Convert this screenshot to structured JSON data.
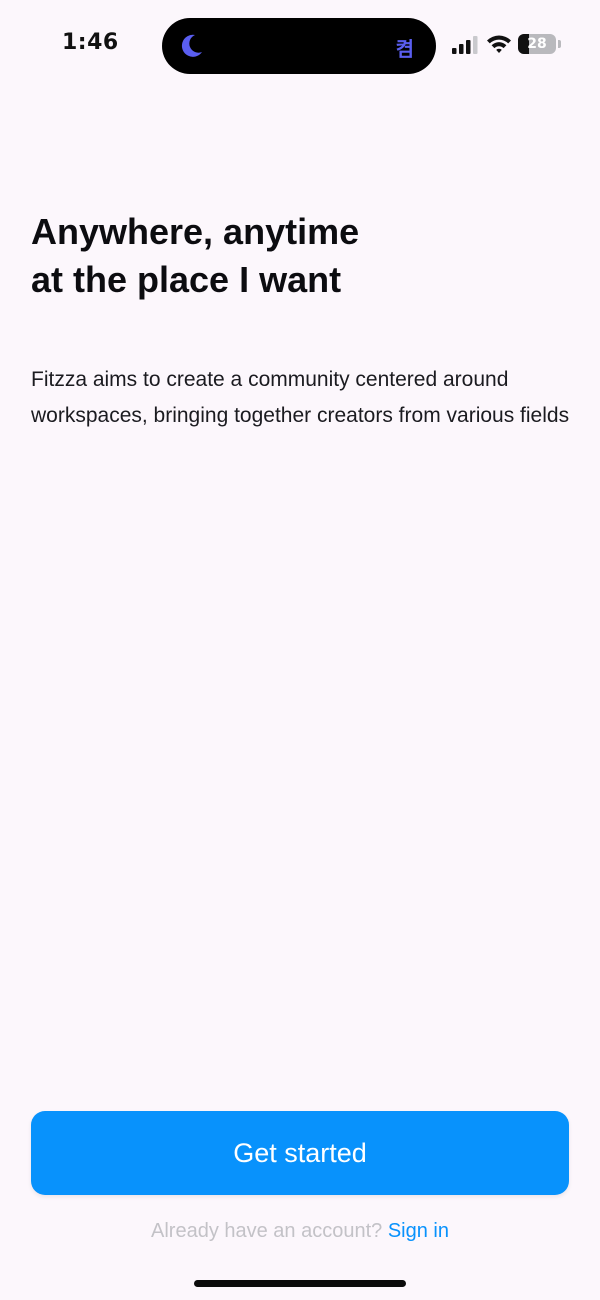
{
  "status_bar": {
    "time": "1:46",
    "island_indicator": "켬",
    "battery_level": "28",
    "battery_fraction": 0.28,
    "icons": [
      "moon-icon",
      "cellular-signal-icon",
      "wifi-icon",
      "battery-icon"
    ]
  },
  "onboarding": {
    "headline_line1": "Anywhere, anytime",
    "headline_line2": "at the place I want",
    "description": "Fitzza aims to create a community centered around workspaces, bringing together creators from various fields"
  },
  "actions": {
    "get_started_label": "Get started",
    "signin_prompt": "Already have an account?",
    "signin_link": "Sign in"
  },
  "colors": {
    "background": "#fcf7fc",
    "accent": "#0892fc",
    "muted_text": "#c3c2c7",
    "moon": "#5a5ef0"
  }
}
